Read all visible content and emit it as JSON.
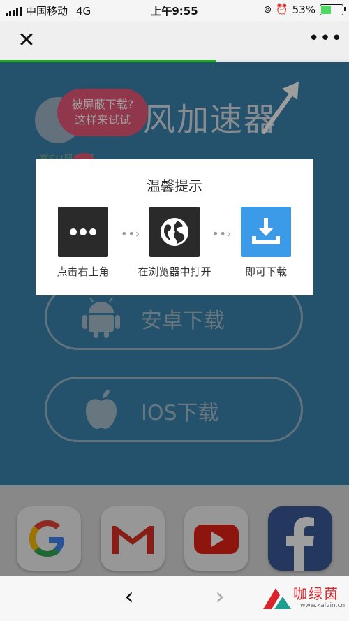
{
  "status_bar": {
    "carrier": "中国移动",
    "network": "4G",
    "time": "上午9:55",
    "battery": "53%",
    "battery_level": 0.53
  },
  "nav": {
    "close_icon": "close-icon",
    "more_icon": "more-icon",
    "progress": 0.62
  },
  "page": {
    "title": "风加速器",
    "subtitle": "原SU风速器",
    "bubble_line1": "被屏蔽下载?",
    "bubble_line2": "这样来试试",
    "android_label": "安卓下载",
    "ios_label": "IOS下载",
    "bg_color": "#3a83ad"
  },
  "modal": {
    "title": "温馨提示",
    "steps": [
      {
        "caption": "点击右上角",
        "icon": "more-dots-icon",
        "color": "#2a2a2a"
      },
      {
        "caption": "在浏览器中打开",
        "icon": "globe-icon",
        "color": "#2a2a2a"
      },
      {
        "caption": "即可下载",
        "icon": "download-tray-icon",
        "color": "#3c9be8"
      }
    ]
  },
  "dock": {
    "apps": [
      "google-icon",
      "gmail-icon",
      "youtube-icon",
      "facebook-icon"
    ]
  },
  "bottom_bar": {
    "back_icon": "chevron-left-icon",
    "forward_icon": "chevron-right-icon",
    "watermark_text": "咖绿茵",
    "watermark_url": "www.kalvin.cn"
  }
}
